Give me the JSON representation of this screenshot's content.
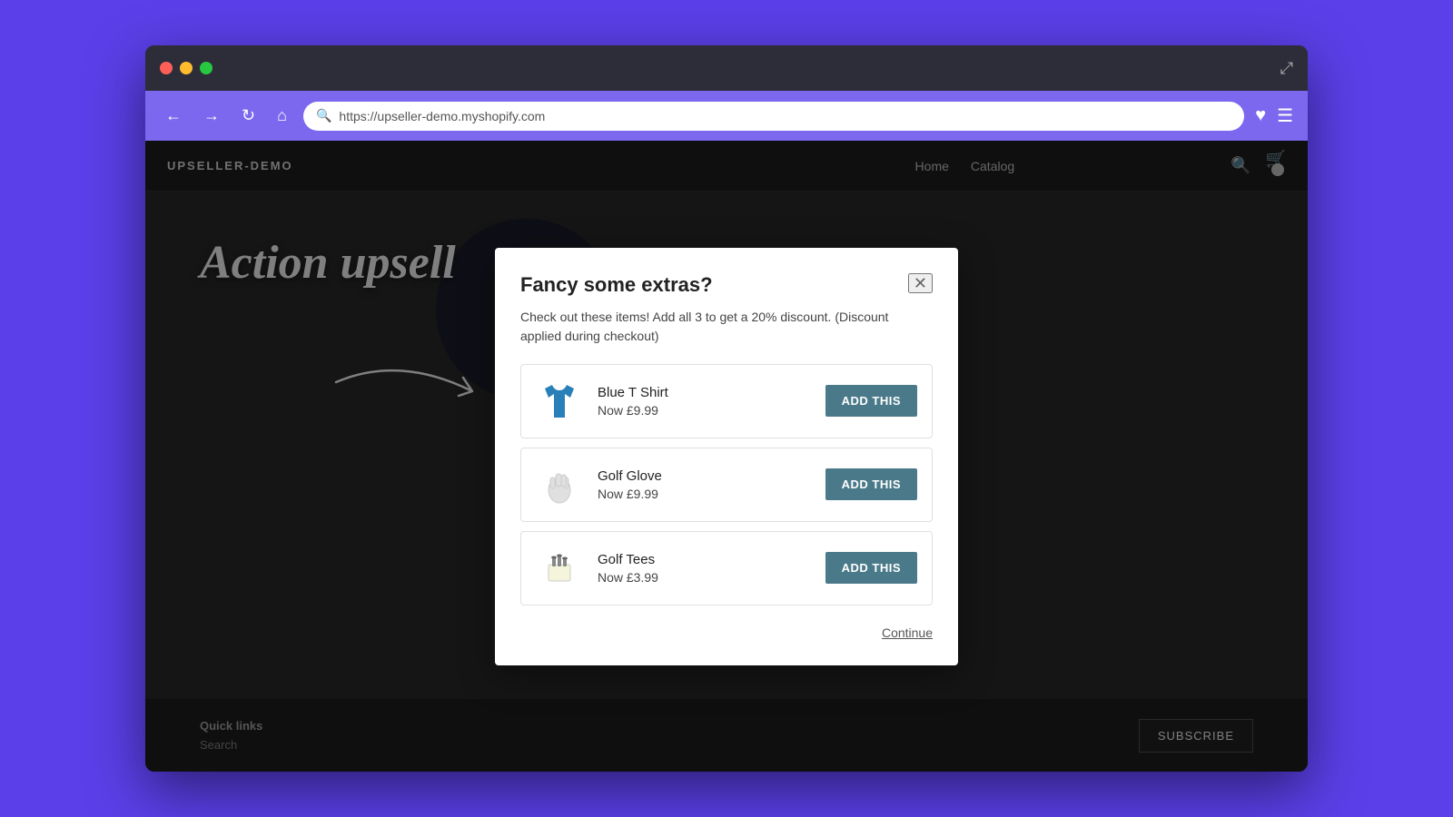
{
  "browser": {
    "url": "https://upseller-demo.myshopify.com",
    "traffic_lights": [
      "red",
      "yellow",
      "green"
    ]
  },
  "site": {
    "logo": "UPSELLER-DEMO",
    "nav": [
      "Home",
      "Catalog"
    ],
    "quick_links_label": "Quick links",
    "search_label": "Search",
    "subscribe_label": "SUBSCRIBE"
  },
  "background": {
    "action_upsell_text": "Action upsell"
  },
  "modal": {
    "title": "Fancy some extras?",
    "description": "Check out these items! Add all 3 to get a 20% discount. (Discount applied during checkout)",
    "close_label": "✕",
    "products": [
      {
        "name": "Blue T Shirt",
        "price": "Now £9.99",
        "button_label": "ADD THIS",
        "icon_type": "tshirt"
      },
      {
        "name": "Golf Glove",
        "price": "Now £9.99",
        "button_label": "ADD THIS",
        "icon_type": "glove"
      },
      {
        "name": "Golf Tees",
        "price": "Now £3.99",
        "button_label": "ADD THIS",
        "icon_type": "tees"
      }
    ],
    "continue_label": "Continue"
  }
}
